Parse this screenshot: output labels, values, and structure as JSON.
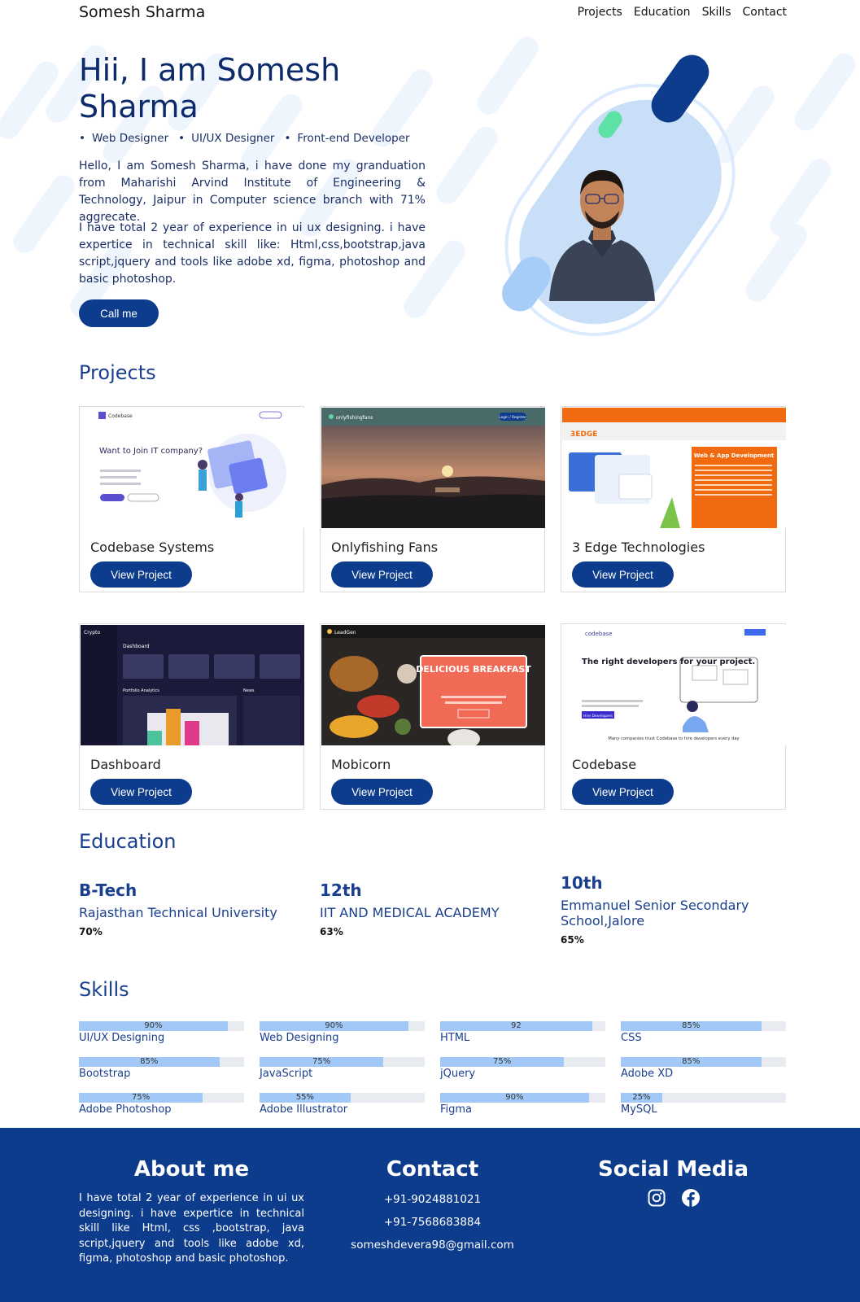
{
  "nav": {
    "brand": "Somesh Sharma",
    "links": [
      "Projects",
      "Education",
      "Skills",
      "Contact"
    ]
  },
  "hero": {
    "title": "Hii, I am Somesh Sharma",
    "roles": [
      "Web Designer",
      "UI/UX Designer",
      "Front-end Developer"
    ],
    "para1": "Hello, I am Somesh Sharma, i have done my granduation from Maharishi Arvind Institute of Engineering & Technology, Jaipur in Computer science branch with 71% aggrecate.",
    "para2": "I have total 2 year of experience in ui ux designing. i have expertice in technical skill like: Html,css,bootstrap,java script,jquery and tools like adobe xd, figma, photoshop and basic photoshop.",
    "cta": "Call me"
  },
  "projects": {
    "heading": "Projects",
    "button_label": "View Project",
    "items": [
      {
        "title": "Codebase Systems",
        "thumb": {
          "logo": "Codebase",
          "heading": "Want to Join IT company?"
        }
      },
      {
        "title": "Onlyfishing Fans",
        "thumb": {
          "logo": "onlyfishingfans",
          "nav_cta": "Login / Register"
        }
      },
      {
        "title": "3 Edge Technologies",
        "thumb": {
          "logo": "3EDGE",
          "heading": "Web & App Development"
        }
      },
      {
        "title": "Dashboard",
        "thumb": {
          "logo": "Crypto",
          "heading": "Dashboard",
          "panel": "Portfolio Analytics",
          "news": "News"
        }
      },
      {
        "title": "Mobicorn",
        "thumb": {
          "logo": "LeadGen",
          "heading": "DELICIOUS BREAKFAST"
        }
      },
      {
        "title": "Codebase",
        "thumb": {
          "logo": "codebase",
          "heading": "The right developers for your project.",
          "tagline": "Many companies trust Codebase to hire developers every day",
          "cta": "Hire Developers"
        }
      }
    ]
  },
  "education": {
    "heading": "Education",
    "items": [
      {
        "degree": "B-Tech",
        "school": "Rajasthan Technical University",
        "score": "70%"
      },
      {
        "degree": "12th",
        "school": "IIT AND MEDICAL ACADEMY",
        "score": "63%"
      },
      {
        "degree": "10th",
        "school": "Emmanuel Senior Secondary School,Jalore",
        "score": "65%"
      }
    ]
  },
  "skills": {
    "heading": "Skills",
    "items": [
      {
        "name": "UI/UX Designing",
        "label": "90%",
        "level": 0.9
      },
      {
        "name": "Web Designing",
        "label": "90%",
        "level": 0.9
      },
      {
        "name": "HTML",
        "label": "92",
        "level": 0.92
      },
      {
        "name": "CSS",
        "label": "85%",
        "level": 0.85
      },
      {
        "name": "Bootstrap",
        "label": "85%",
        "level": 0.85
      },
      {
        "name": "JavaScript",
        "label": "75%",
        "level": 0.75
      },
      {
        "name": "jQuery",
        "label": "75%",
        "level": 0.75
      },
      {
        "name": "Adobe XD",
        "label": "85%",
        "level": 0.85
      },
      {
        "name": "Adobe Photoshop",
        "label": "75%",
        "level": 0.75
      },
      {
        "name": "Adobe Illustrator",
        "label": "55%",
        "level": 0.55
      },
      {
        "name": "Figma",
        "label": "90%",
        "level": 0.9
      },
      {
        "name": "MySQL",
        "label": "25%",
        "level": 0.25
      }
    ]
  },
  "footer": {
    "about_heading": "About me",
    "about_text": "I have total 2 year of experience in ui ux designing. i have expertice in technical skill like Html, css ,bootstrap, java script,jquery and tools like adobe xd, figma, photoshop and basic photoshop.",
    "contact_heading": "Contact",
    "phone1": "+91-9024881021",
    "phone2": "+91-7568683884",
    "email": "someshdevera98@gmail.com",
    "social_heading": "Social Media",
    "social_icons": [
      "instagram-icon",
      "facebook-icon"
    ]
  },
  "colors": {
    "primary": "#0d3c8c",
    "heading": "#1a3f8f",
    "skill_fill": "#a2c8f7",
    "accent_green": "#5ee1a6"
  }
}
